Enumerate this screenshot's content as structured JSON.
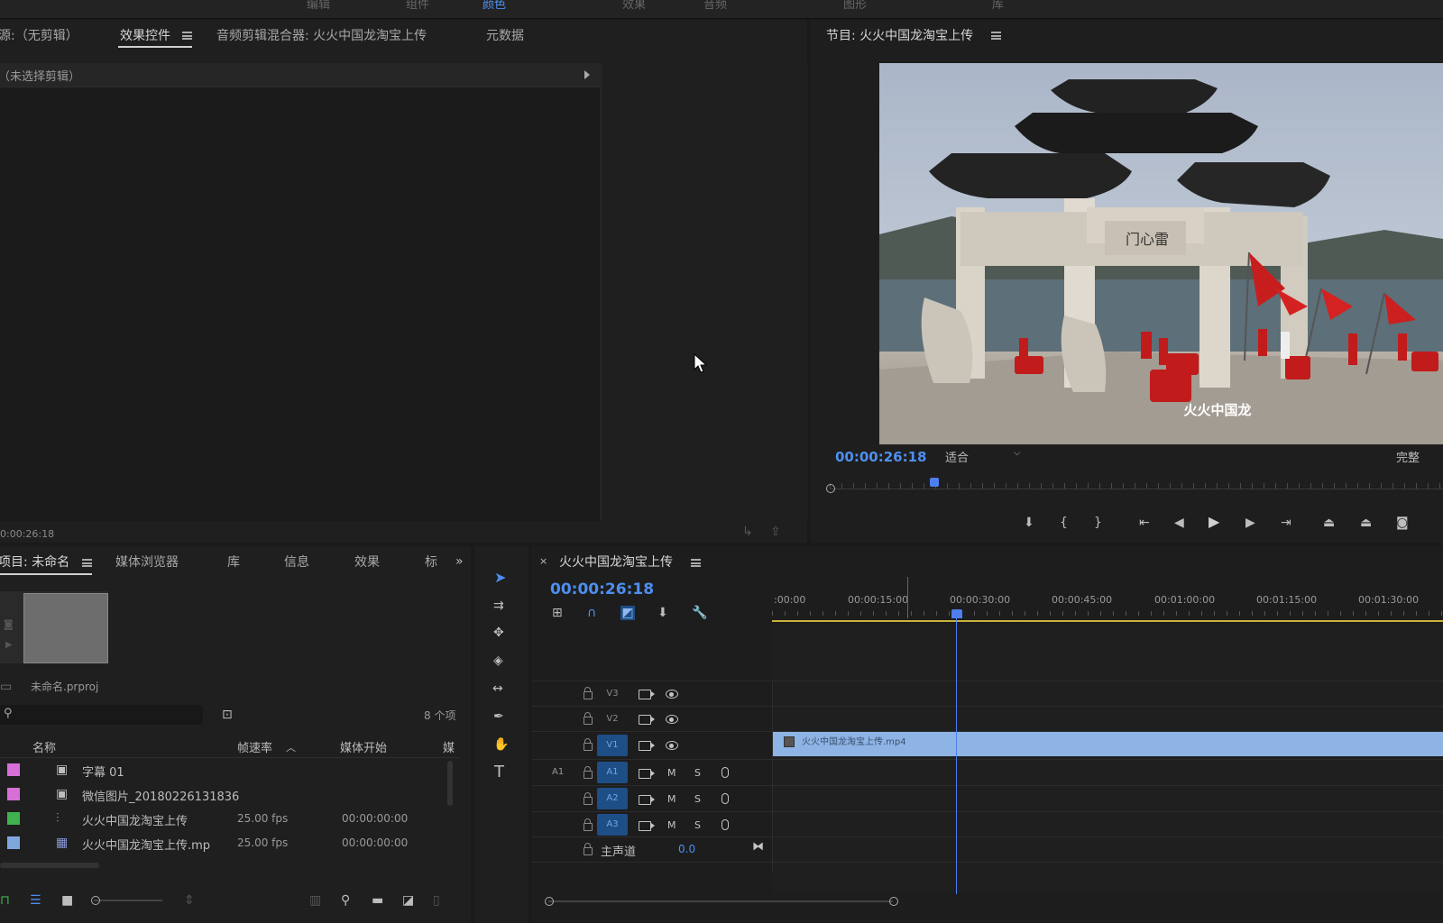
{
  "colors": {
    "accent_blue": "#4d8ff0",
    "playhead": "#4d7ff0",
    "clip_blue": "#8eb4e6",
    "work_area_yellow": "#c8b43a",
    "label_pink": "#d66fd6",
    "label_green": "#3fb14f",
    "label_blue": "#7ea7de"
  },
  "top_menu": [
    "编辑",
    "组件",
    "颜色",
    "效果",
    "音频",
    "图形",
    "库"
  ],
  "source_panel": {
    "tabs": [
      "源:（无剪辑）",
      "效果控件",
      "音频剪辑混合器: 火火中国龙淘宝上传",
      "元数据"
    ],
    "active_tab": "效果控件",
    "no_clip_label": "（未选择剪辑）",
    "timecode": "0:00:26:18"
  },
  "program_monitor": {
    "title": "节目: 火火中国龙淘宝上传",
    "timecode": "00:00:26:18",
    "fit_value": "适合",
    "quality_value": "完整",
    "subtitle_text": "火火中国龙",
    "plaque_text": "门心雷",
    "playhead_fraction": 0.17
  },
  "project_panel": {
    "tabs": [
      "项目: 未命名",
      "媒体浏览器",
      "库",
      "信息",
      "效果",
      "标"
    ],
    "project_file": "未命名.prproj",
    "search_placeholder": "",
    "item_count": "8 个项",
    "columns": [
      "名称",
      "帧速率",
      "媒体开始",
      "媒"
    ],
    "rows": [
      {
        "name": "字幕 01",
        "fps": "",
        "start": "",
        "color": "#d66fd6",
        "icon": "title-icon"
      },
      {
        "name": "微信图片_20180226131836",
        "fps": "",
        "start": "",
        "color": "#d66fd6",
        "icon": "image-icon"
      },
      {
        "name": "火火中国龙淘宝上传",
        "fps": "25.00 fps",
        "start": "00:00:00:00",
        "color": "#3fb14f",
        "icon": "sequence-icon"
      },
      {
        "name": "火火中国龙淘宝上传.mp",
        "fps": "25.00 fps",
        "start": "00:00:00:00",
        "color": "#7ea7de",
        "icon": "video-icon"
      }
    ]
  },
  "timeline": {
    "title": "火火中国龙淘宝上传",
    "timecode": "00:00:26:18",
    "ruler_labels": [
      ":00:00",
      "00:00:15:00",
      "00:00:30:00",
      "00:00:45:00",
      "00:01:00:00",
      "00:01:15:00",
      "00:01:30:00"
    ],
    "video_tracks": [
      "V3",
      "V2",
      "V1"
    ],
    "audio_tracks": [
      "A1",
      "A2",
      "A3"
    ],
    "source_patch_label": "A1",
    "mute_label": "M",
    "solo_label": "S",
    "master_label": "主声道",
    "master_value": "0.0",
    "clip_name": "火火中国龙淘宝上传.mp4"
  },
  "tools": [
    "selection-tool",
    "track-select-tool",
    "ripple-edit-tool",
    "razor-tool",
    "slip-tool",
    "pen-tool",
    "hand-tool",
    "type-tool"
  ]
}
